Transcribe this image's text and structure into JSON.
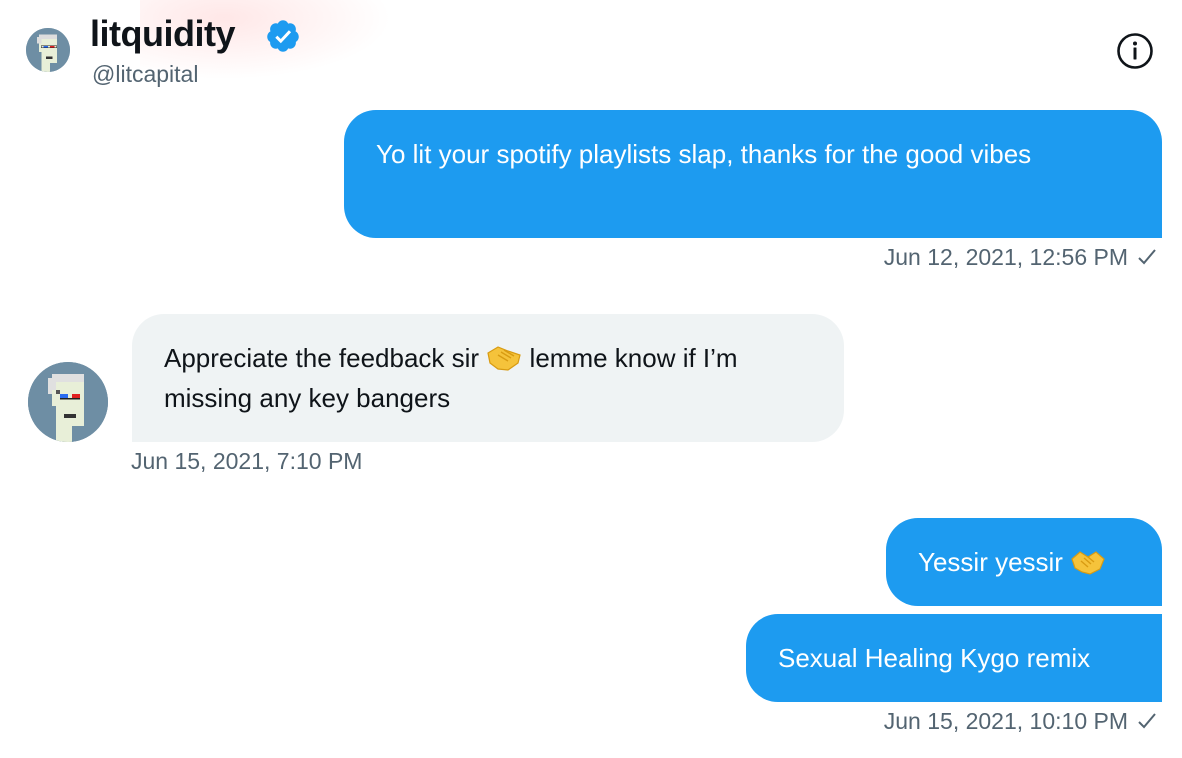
{
  "header": {
    "display_name": "litquidity",
    "handle": "@litcapital",
    "verified": true,
    "avatar_icon": "punk-avatar-icon",
    "info_icon": "info-icon"
  },
  "messages": [
    {
      "direction": "sent",
      "text": "Yo lit your spotify playlists slap, thanks for the good vibes"
    },
    {
      "direction": "received",
      "text_before": "Appreciate the feedback sir",
      "emoji": "handshake",
      "text_after": "lemme know if I’m missing any key bangers"
    },
    {
      "direction": "sent",
      "text": "Yessir yessir",
      "emoji": "handshake"
    },
    {
      "direction": "sent",
      "text": "Sexual Healing Kygo remix"
    }
  ],
  "timestamps": [
    "Jun 12, 2021, 12:56 PM",
    "Jun 15, 2021, 7:10 PM",
    "Jun 15, 2021, 10:10 PM"
  ],
  "colors": {
    "sent_bubble": "#1d9bf0",
    "received_bubble": "#eff3f4",
    "secondary_text": "#536471",
    "verified_badge": "#1d9bf0"
  }
}
